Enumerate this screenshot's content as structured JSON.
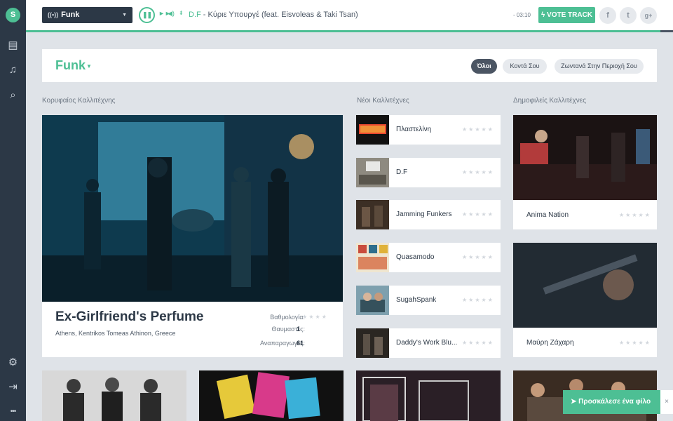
{
  "sidebar": {
    "logo_icon": "logo-icon",
    "items": [
      {
        "name": "playlist-icon",
        "glyph": "▤"
      },
      {
        "name": "headphones-icon",
        "glyph": "♫"
      },
      {
        "name": "search-icon",
        "glyph": "⌕"
      },
      {
        "name": "settings-icon",
        "glyph": "⚙"
      },
      {
        "name": "logout-icon",
        "glyph": "⇥"
      },
      {
        "name": "more-icon",
        "glyph": "•••"
      }
    ]
  },
  "player": {
    "station": "Funk",
    "progress_fraction": 0.98,
    "now_playing_artist": "D.F",
    "now_playing_sep": " - ",
    "now_playing_title": "Κύριε Υπουργέ (feat. Eisvoleas & Taki Tsan)",
    "time": "- 03:10",
    "vote_label": "VOTE TRACK",
    "social": [
      "f",
      "t",
      "g+"
    ]
  },
  "filter": {
    "genre": "Funk",
    "pills": [
      "Όλοι",
      "Κοντά Σου",
      "Ζωντανά Στην Περιοχή Σου"
    ],
    "active_pill": 0
  },
  "sections": {
    "top_artist_title": "Κορυφαίος Καλλιτέχνης",
    "new_artists_title": "Νέοι Καλλιτέχνες",
    "popular_title": "Δημοφιλείς Καλλιτέχνες"
  },
  "top_artist": {
    "name": "Ex-Girlfriend's Perfume",
    "location": "Athens, Kentrikos Tomeas Athinon, Greece",
    "rating_label": "Βαθμολογία:",
    "fans_label": "Θαυμαστές:",
    "fans": "1",
    "plays_label": "Αναπαραγωγές:",
    "plays": "61",
    "rating_stars": "★★★★★"
  },
  "new_artists": [
    {
      "name": "Πλαστελίνη",
      "stars": "★★★★★"
    },
    {
      "name": "D.F",
      "stars": "★★★★★"
    },
    {
      "name": "Jamming Funkers",
      "stars": "★★★★★"
    },
    {
      "name": "Quasamodo",
      "stars": "★★★★★"
    },
    {
      "name": "SugahSpank",
      "stars": "★★★★★"
    },
    {
      "name": "Daddy's Work Blu...",
      "stars": "★★★★★"
    }
  ],
  "popular_artists": [
    {
      "name": "Anima Nation",
      "stars": "★★★★★"
    },
    {
      "name": "Μαύρη Ζάχαρη",
      "stars": "★★★★★"
    }
  ],
  "invite": {
    "label": "Προσκάλεσε ένα φίλο",
    "close": "×"
  },
  "colors": {
    "accent": "#4dbf94",
    "sidebar": "#2c3846",
    "background": "#dfe3e8"
  }
}
